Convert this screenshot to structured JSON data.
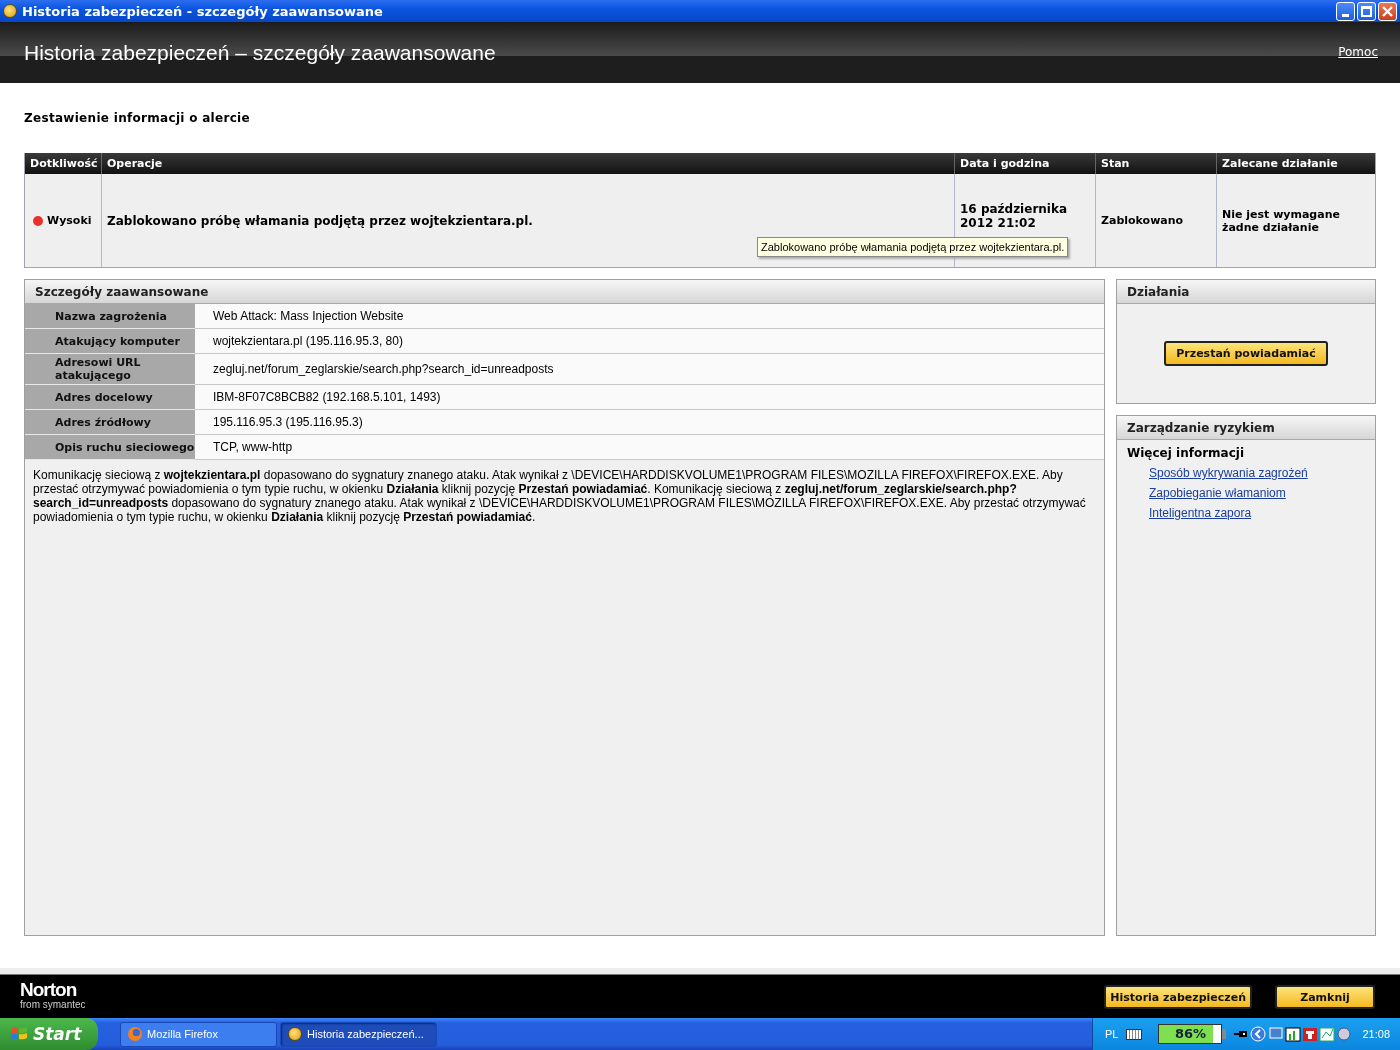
{
  "window": {
    "title": "Historia zabezpieczeń - szczegóły zaawansowane"
  },
  "header": {
    "title": "Historia zabezpieczeń – szczegóły zaawansowane",
    "help_link": "Pomoc"
  },
  "summary_heading": "Zestawienie informacji o alercie",
  "alerts": {
    "columns": [
      "Dotkliwość",
      "Operacje",
      "Data i godzina",
      "Stan",
      "Zalecane działanie"
    ],
    "rows": [
      {
        "severity": "Wysoki",
        "color": "#e8312a",
        "operation": "Zablokowano próbę włamania podjętą przez wojtekzientara.pl.",
        "datetime": "16 października 2012 21:02",
        "status": "Zablokowano",
        "recommended": "Nie jest wymagane żadne działanie"
      }
    ],
    "tooltip": "Zablokowano próbę włamania podjętą przez wojtekzientara.pl."
  },
  "details": {
    "title": "Szczegóły zaawansowane",
    "rows": [
      {
        "label": "Nazwa zagrożenia",
        "value": "Web Attack: Mass Injection Website"
      },
      {
        "label": "Atakujący komputer",
        "value": "wojtekzientara.pl (195.116.95.3, 80)"
      },
      {
        "label": "Adresowi URL atakującego",
        "value": "zegluj.net/forum_zeglarskie/search.php?search_id=unreadposts"
      },
      {
        "label": "Adres docelowy",
        "value": "IBM-8F07C8BCB82 (192.168.5.101, 1493)"
      },
      {
        "label": "Adres źródłowy",
        "value": "195.116.95.3 (195.116.95.3)"
      },
      {
        "label": "Opis ruchu sieciowego",
        "value": "TCP, www-http"
      }
    ],
    "description": "Komunikację sieciową z **wojtekzientara.pl** dopasowano do sygnatury znanego ataku. Atak wynikał z \\DEVICE\\HARDDISKVOLUME1\\PROGRAM FILES\\MOZILLA FIREFOX\\FIREFOX.EXE. Aby przestać otrzymywać powiadomienia o tym typie ruchu, w okienku **Działania** kliknij pozycję **Przestań powiadamiać**. Komunikację sieciową z **zegluj.net/forum_zeglarskie/search.php?search_id=unreadposts** dopasowano do sygnatury znanego ataku. Atak wynikał z \\DEVICE\\HARDDISKVOLUME1\\PROGRAM FILES\\MOZILLA FIREFOX\\FIREFOX.EXE. Aby przestać otrzymywać powiadomienia o tym typie ruchu, w okienku **Działania** kliknij pozycję **Przestań powiadamiać**."
  },
  "actions": {
    "title": "Działania",
    "button": "Przestań powiadamiać"
  },
  "risk": {
    "title": "Zarządzanie ryzykiem",
    "subtitle": "Więcej informacji",
    "links": [
      "Sposób wykrywania zagrożeń",
      "Zapobieganie włamaniom",
      "Inteligentna zapora"
    ]
  },
  "footer": {
    "logo": "Norton",
    "logo_sub": "from symantec",
    "buttons": [
      "Historia zabezpieczeń",
      "Zamknij"
    ]
  },
  "taskbar": {
    "start": "Start",
    "tasks": [
      {
        "label": "Mozilla Firefox",
        "selected": false
      },
      {
        "label": "Historia zabezpieczeń...",
        "selected": true
      }
    ],
    "language": "PL",
    "battery": {
      "reading": "86%",
      "level": 0.86
    },
    "clock": "21:08"
  }
}
